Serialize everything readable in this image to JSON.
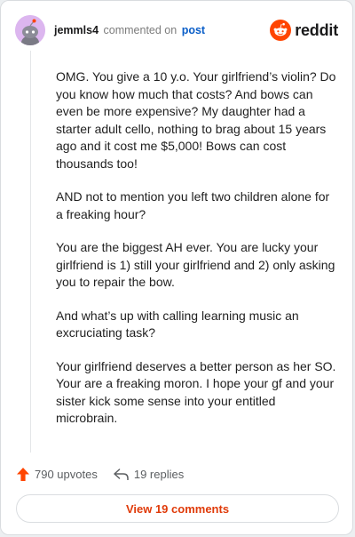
{
  "header": {
    "username": "jemmls4",
    "verb": "commented on",
    "target": "post",
    "brand": "reddit"
  },
  "comment": {
    "paragraphs": [
      "OMG. You give a 10 y.o. Your girlfriend’s violin? Do you know how much that costs? And bows can even be more expensive? My daughter had a starter adult cello, nothing to brag about 15 years ago and it cost me $5,000! Bows can cost thousands too!",
      "AND not to mention you left two children alone for a freaking hour?",
      "You are the biggest AH ever. You are lucky your girlfriend is 1) still your girlfriend and 2) only asking you to repair the bow.",
      "And what’s up with calling learning music an excruciating task?",
      "Your girlfriend deserves a better person as her SO. Your are a freaking moron. I hope your gf and your sister kick some sense into your entitled microbrain."
    ]
  },
  "actions": {
    "upvotes": "790 upvotes",
    "replies": "19 replies"
  },
  "footer": {
    "view_label": "View 19 comments"
  },
  "colors": {
    "accent": "#ff4500",
    "link": "#0a5ec8",
    "avatar_bg": "#dcb6ef"
  },
  "icons": {
    "avatar": "snoo-avatar-icon",
    "brand": "reddit-logo-icon",
    "upvote": "upvote-arrow-icon",
    "reply": "reply-arrow-icon"
  }
}
